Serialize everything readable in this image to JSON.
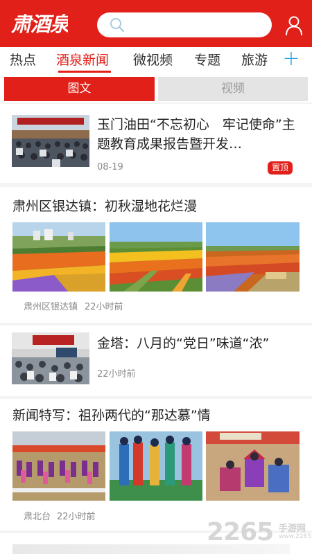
{
  "header": {
    "logo_text": "肃酒泉",
    "search_placeholder": ""
  },
  "nav": {
    "tabs": [
      "热点",
      "酒泉新闻",
      "微视频",
      "专题",
      "旅游"
    ],
    "active_index": 1,
    "plus": "+"
  },
  "segment": {
    "left_label": "图文",
    "right_label": "视频"
  },
  "feed": [
    {
      "title": "玉门油田“不忘初心　牢记使命”主题教育成果报告暨开发…",
      "date": "08-19",
      "badge": "置顶"
    },
    {
      "title": "肃州区银达镇：初秋湿地花烂漫",
      "source": "肃州区银达镇",
      "time": "22小时前"
    },
    {
      "title": "金塔：八月的“党日”味道“浓”",
      "time": "22小时前"
    },
    {
      "title": "新闻特写：祖孙两代的“那达慕”情",
      "source": "肃北台",
      "time": "22小时前"
    }
  ],
  "watermark": {
    "number": "2265",
    "sub": "手游网",
    "url": "www.2265.com"
  },
  "colors": {
    "brand_red": "#e02019",
    "plus_blue": "#2aa6e0"
  }
}
